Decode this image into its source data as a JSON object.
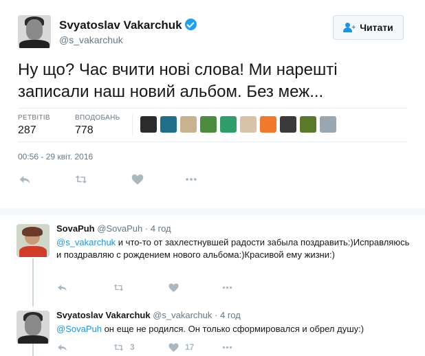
{
  "main_tweet": {
    "author_name": "Svyatoslav Vakarchuk",
    "author_handle": "@s_vakarchuk",
    "follow_label": "Читати",
    "text": "Ну що? Час вчити нові слова! Ми нарешті записали наш новий альбом. Без меж...",
    "retweets_label": "РЕТВІТІВ",
    "retweets_count": "287",
    "likes_label": "ВПОДОБАНЬ",
    "likes_count": "778",
    "timestamp": "00:56 - 29 квіт. 2016",
    "liker_colors": [
      "#2b2b2b",
      "#1f6f8b",
      "#c9b28f",
      "#4c8a3f",
      "#2f9e6b",
      "#d9c3a8",
      "#f07a2a",
      "#3a3a3a",
      "#5a7a2a",
      "#9aa7b0"
    ]
  },
  "replies": [
    {
      "name": "SovaPuh",
      "handle": "@SovaPuh",
      "dot": "·",
      "time": "4 год",
      "mention": "@s_vakarchuk",
      "text": " и что-то от захлестнувшей радости забыла поздравить:)Исправляюсь и поздравляю с  рождением нового альбома:)Красивой ему жизни:)",
      "retweets": "",
      "likes": ""
    },
    {
      "name": "Svyatoslav Vakarchuk",
      "handle": "@s_vakarchuk",
      "dot": "·",
      "time": "4 год",
      "mention": "@SovaPuh",
      "text": " он еще не родился. Он только сформировался и обрел душу:)",
      "retweets": "3",
      "likes": "17"
    }
  ],
  "colors": {
    "accent": "#1da1f2",
    "link": "#1b95e0",
    "muted": "#657786",
    "action_icons": "#aab8c2"
  },
  "icons": [
    "verified-badge-icon",
    "follow-user-icon",
    "reply-icon",
    "retweet-icon",
    "heart-icon",
    "more-icon"
  ]
}
